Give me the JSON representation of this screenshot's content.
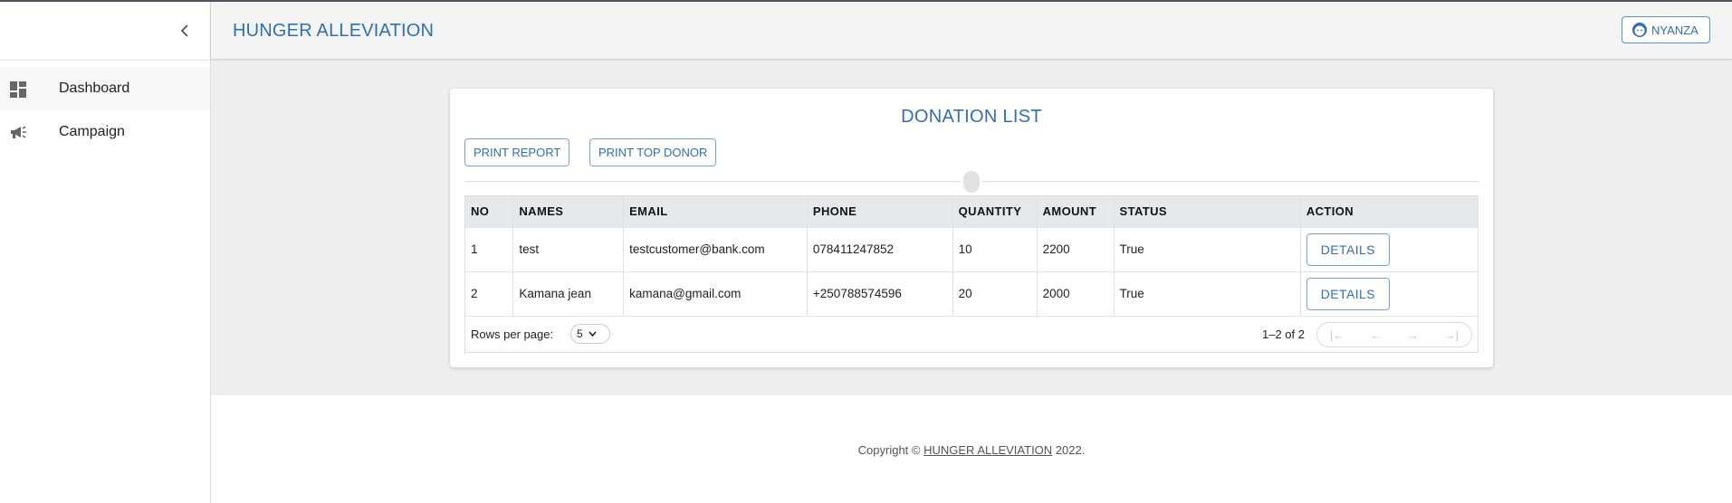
{
  "app": {
    "title": "HUNGER ALLEVIATION"
  },
  "sidebar": {
    "collapse_icon": "chevron-left-icon",
    "items": [
      {
        "label": "Dashboard",
        "icon": "dashboard-icon",
        "active": true
      },
      {
        "label": "Campaign",
        "icon": "campaign-icon",
        "active": false
      }
    ]
  },
  "header": {
    "user_label": "NYANZA",
    "user_icon": "face-icon",
    "accent": "#2f6fb7"
  },
  "page": {
    "title": "DONATION LIST",
    "print_report_label": "PRINT REPORT",
    "print_top_donor_label": "PRINT TOP DONOR"
  },
  "table": {
    "columns": [
      "NO",
      "NAMES",
      "EMAIL",
      "PHONE",
      "QUANTITY",
      "AMOUNT",
      "STATUS",
      "ACTION"
    ],
    "rows": [
      {
        "no": "1",
        "name": "test",
        "email": "testcustomer@bank.com",
        "phone": "078411247852",
        "quantity": "10",
        "amount": "2200",
        "status": "True",
        "action": "DETAILS"
      },
      {
        "no": "2",
        "name": "Kamana jean",
        "email": "kamana@gmail.com",
        "phone": "+250788574596",
        "quantity": "20",
        "amount": "2000",
        "status": "True",
        "action": "DETAILS"
      }
    ],
    "rows_per_page_label": "Rows per page:",
    "rows_per_page_value": "5",
    "range_text": "1–2 of 2"
  },
  "footer": {
    "prefix": "Copyright © ",
    "link": "HUNGER ALLEVIATION",
    "suffix": " 2022."
  }
}
